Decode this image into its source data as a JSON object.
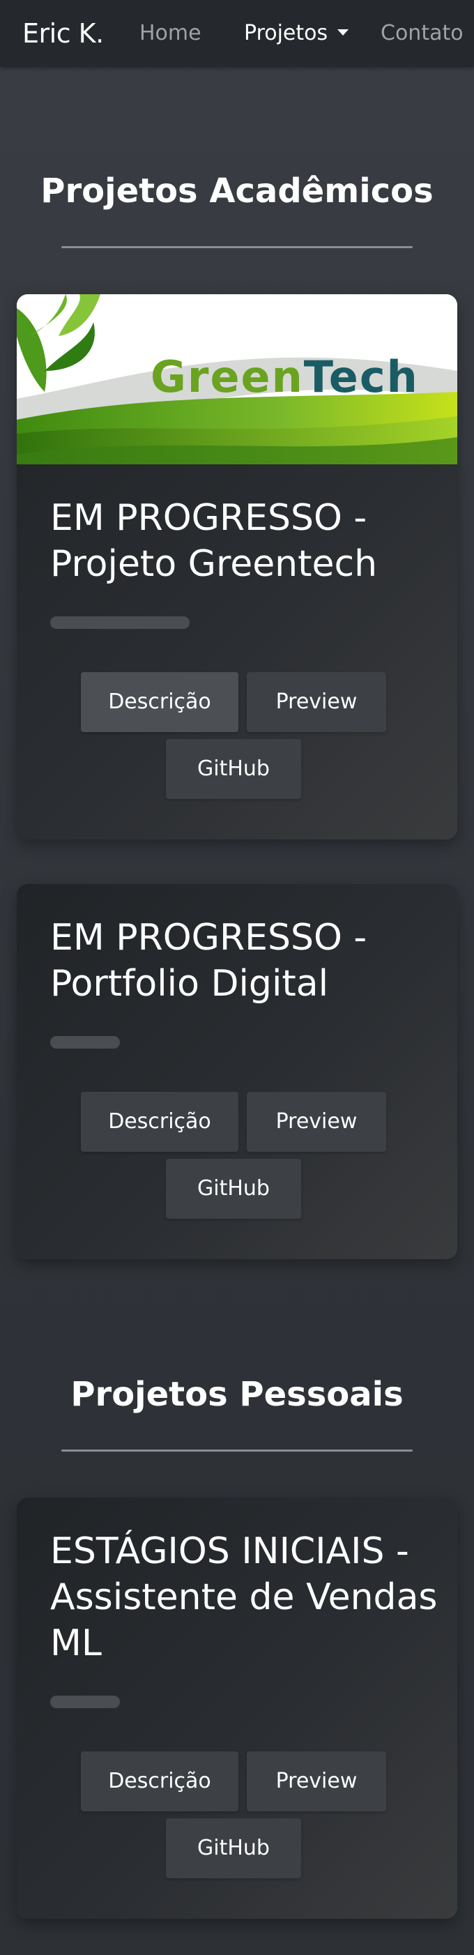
{
  "navbar": {
    "brand": "Eric K.",
    "links": [
      {
        "label": "Home"
      },
      {
        "label": "Projetos"
      },
      {
        "label": "Contato"
      }
    ]
  },
  "sections": [
    {
      "title": "Projetos Acadêmicos",
      "cards": [
        {
          "image_logo_text": [
            "Green",
            "Tech"
          ],
          "title": "EM PROGRESSO - Projeto Greentech",
          "buttons": [
            "Descrição",
            "Preview",
            "GitHub"
          ]
        },
        {
          "title": "EM PROGRESSO - Portfolio Digital",
          "buttons": [
            "Descrição",
            "Preview",
            "GitHub"
          ]
        }
      ]
    },
    {
      "title": "Projetos Pessoais",
      "cards": [
        {
          "title": "ESTÁGIOS INICIAIS - Assistente de Vendas ML",
          "buttons": [
            "Descrição",
            "Preview",
            "GitHub"
          ]
        }
      ]
    }
  ],
  "colors": {
    "background": "#33373c",
    "navbar": "#25282c",
    "card": "#26292d",
    "button": "#3d4044",
    "logo_green": "#6aa320",
    "logo_teal": "#1a5c64"
  }
}
